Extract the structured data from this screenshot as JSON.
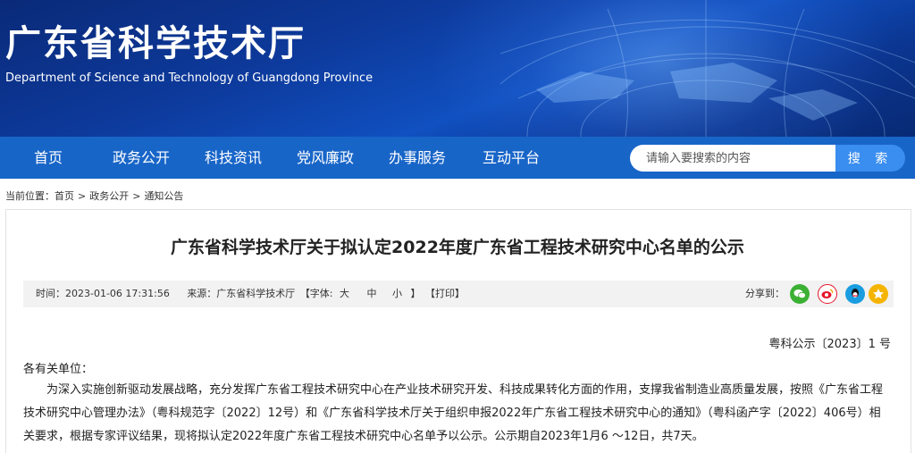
{
  "header": {
    "title": "广东省科学技术厅",
    "subtitle": "Department of Science and Technology of Guangdong Province"
  },
  "nav": {
    "items": [
      "首页",
      "政务公开",
      "科技资讯",
      "党风廉政",
      "办事服务",
      "互动平台"
    ]
  },
  "search": {
    "placeholder": "请输入要搜索的内容",
    "button_label": "搜 索"
  },
  "breadcrumb": {
    "prefix": "当前位置：",
    "items": [
      "首页",
      "政务公开",
      "通知公告"
    ]
  },
  "article": {
    "title": "广东省科学技术厅关于拟认定2022年度广东省工程技术研究中心名单的公示",
    "time": "时间：2023-01-06 17:31:56",
    "source": "来源：广东省科学技术厅",
    "font_label": "【字体:",
    "font_large": "大",
    "font_medium": "中",
    "font_small": "小",
    "font_close": "】",
    "print_label": "【打印】",
    "share_label": "分享到：",
    "doc_number": "粤科公示〔2023〕1 号",
    "salutation": "各有关单位：",
    "body": "为深入实施创新驱动发展战略，充分发挥广东省工程技术研究中心在产业技术研究开发、科技成果转化方面的作用，支撑我省制造业高质量发展，按照《广东省工程技术研究中心管理办法》（粤科规范字〔2022〕12号）和《广东省科学技术厅关于组织申报2022年广东省工程技术研究中心的通知》（粤科函产字〔2022〕406号）相关要求，根据专家评议结果，现将拟认定2022年度广东省工程技术研究中心名单予以公示。公示期自2023年1月6 ～12日，共7天。"
  },
  "share_icons": [
    {
      "name": "wechat-icon",
      "color": "#3cb034"
    },
    {
      "name": "weibo-icon",
      "color": "#e6162d"
    },
    {
      "name": "qq-icon",
      "color": "#1a9de0"
    },
    {
      "name": "qzone-icon",
      "color": "#f5b400"
    }
  ],
  "colors": {
    "nav_bg": "#1865c8",
    "search_button": "#3a8ef0"
  }
}
